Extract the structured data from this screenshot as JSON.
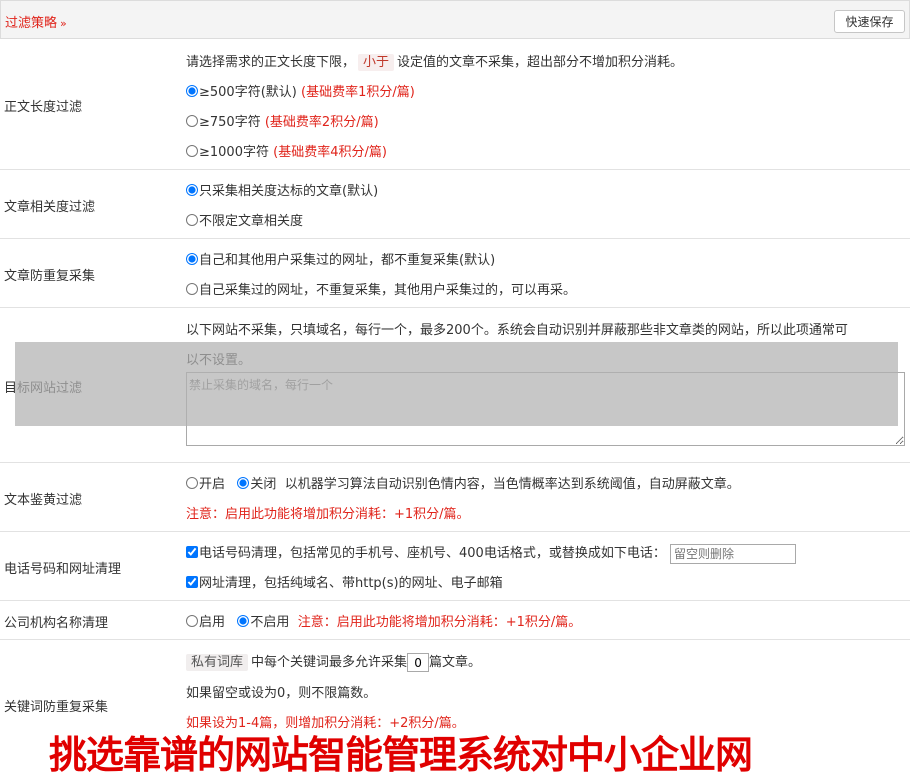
{
  "header": {
    "title": "过滤策略",
    "chevron": "»",
    "save_label": "快速保存"
  },
  "sections": {
    "length": {
      "label": "正文长度过滤",
      "desc_before": "请选择需求的正文长度下限，",
      "desc_pill": "小于",
      "desc_after": "设定值的文章不采集，超出部分不增加积分消耗。",
      "options": [
        {
          "text": "≥500字符(默认)",
          "note": "(基础费率1积分/篇)",
          "checked": true
        },
        {
          "text": "≥750字符",
          "note": "(基础费率2积分/篇)",
          "checked": false
        },
        {
          "text": "≥1000字符",
          "note": "(基础费率4积分/篇)",
          "checked": false
        }
      ]
    },
    "relevance": {
      "label": "文章相关度过滤",
      "options": [
        "只采集相关度达标的文章(默认)",
        "不限定文章相关度"
      ]
    },
    "dedup": {
      "label": "文章防重复采集",
      "options": [
        "自己和其他用户采集过的网址，都不重复采集(默认)",
        "自己采集过的网址，不重复采集，其他用户采集过的，可以再采。"
      ]
    },
    "target": {
      "label": "目标网站过滤",
      "desc_line1": "以下网站不采集，只填域名，每行一个，最多200个。系统会自动识别并屏蔽那些非文章类的网站，所以此项通常可",
      "desc_line2": "以不设置。",
      "placeholder": "禁止采集的域名，每行一个"
    },
    "porn": {
      "label": "文本鉴黄过滤",
      "on": "开启",
      "off": "关闭",
      "desc": "以机器学习算法自动识别色情内容，当色情概率达到系统阈值，自动屏蔽文章。",
      "note": "注意：启用此功能将增加积分消耗：+1积分/篇。"
    },
    "phone": {
      "label": "电话号码和网址清理",
      "phone_text": "电话号码清理，包括常见的手机号、座机号、400电话格式，或替换成如下电话：",
      "phone_placeholder": "留空则删除",
      "url_text": "网址清理，包括纯域名、带http(s)的网址、电子邮箱"
    },
    "company": {
      "label": "公司机构名称清理",
      "on": "启用",
      "off": "不启用",
      "note": "注意：启用此功能将增加积分消耗：+1积分/篇。"
    },
    "keyword": {
      "label": "关键词防重复采集",
      "pill": "私有词库",
      "text_before": "中每个关键词最多允许采集",
      "value": "0",
      "text_after": "篇文章。",
      "line2": "如果留空或设为0，则不限篇数。",
      "line3": "如果设为1-4篇，则增加积分消耗：+2积分/篇。"
    }
  },
  "watermark": "挑选靠谱的网站智能管理系统对中小企业网",
  "colors": {
    "accent_red": "#e0241b",
    "overlay_gray": "#b2b2b2",
    "header_bg": "#f4f4f4"
  }
}
